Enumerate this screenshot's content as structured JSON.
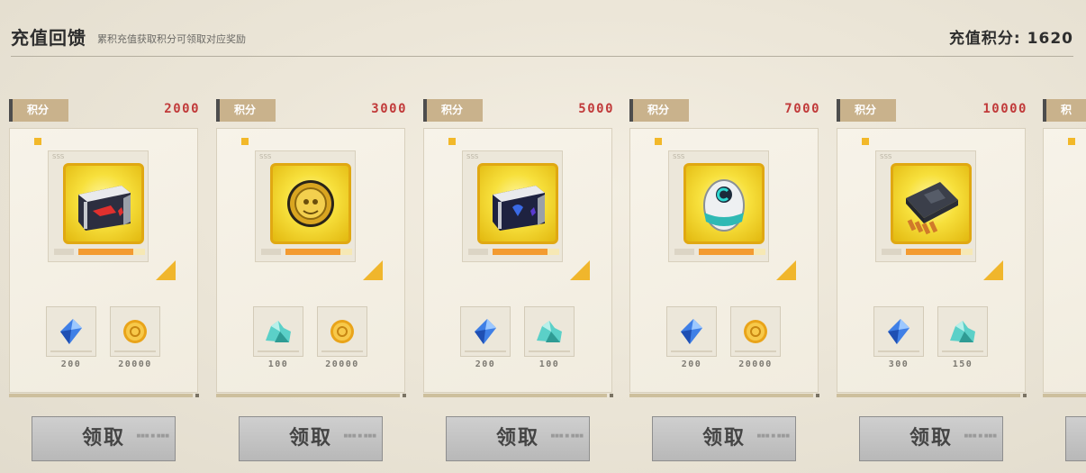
{
  "header": {
    "title": "充值回馈",
    "subtitle": "累积充值获取积分可领取对应奖励",
    "points_label": "充值积分:",
    "points_value": "1620"
  },
  "colors": {
    "accent_red": "#c13a3a",
    "tag_bg": "#c9b28c",
    "gold_frame": "#f7e03c",
    "progress": "#f39b31"
  },
  "cards": [
    {
      "tag": "积分",
      "required": "2000",
      "rarity": "SSS",
      "main_icon": "red-white-crate-icon",
      "rewards": [
        {
          "icon": "blue-crystal-icon",
          "qty": "200"
        },
        {
          "icon": "gold-coin-icon",
          "qty": "20000"
        }
      ],
      "claim_label": "领取"
    },
    {
      "tag": "积分",
      "required": "3000",
      "rarity": "SSS",
      "main_icon": "golden-medallion-icon",
      "rewards": [
        {
          "icon": "teal-ore-icon",
          "qty": "100"
        },
        {
          "icon": "gold-coin-icon",
          "qty": "20000"
        }
      ],
      "claim_label": "领取"
    },
    {
      "tag": "积分",
      "required": "5000",
      "rarity": "SSS",
      "main_icon": "blue-crate-icon",
      "rewards": [
        {
          "icon": "blue-crystal-icon",
          "qty": "200"
        },
        {
          "icon": "teal-ore-icon",
          "qty": "100"
        }
      ],
      "claim_label": "领取"
    },
    {
      "tag": "积分",
      "required": "7000",
      "rarity": "SSS",
      "main_icon": "tech-egg-icon",
      "rewards": [
        {
          "icon": "blue-crystal-icon",
          "qty": "200"
        },
        {
          "icon": "gold-coin-icon",
          "qty": "20000"
        }
      ],
      "claim_label": "领取"
    },
    {
      "tag": "积分",
      "required": "10000",
      "rarity": "SSS",
      "main_icon": "microchip-icon",
      "rewards": [
        {
          "icon": "blue-crystal-icon",
          "qty": "300"
        },
        {
          "icon": "teal-ore-icon",
          "qty": "150"
        }
      ],
      "claim_label": "领取"
    },
    {
      "tag": "积",
      "required": "",
      "rarity": "",
      "main_icon": "",
      "rewards": [],
      "claim_label": ""
    }
  ]
}
